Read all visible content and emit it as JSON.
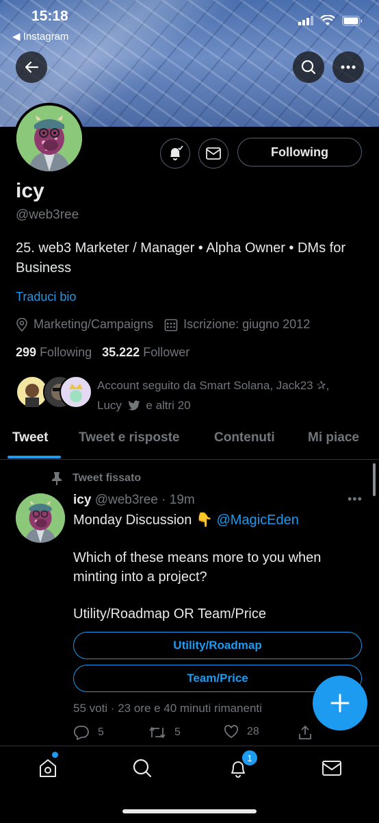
{
  "status_bar": {
    "time": "15:18",
    "back_app": "◀ Instagram"
  },
  "profile": {
    "following_button": "Following",
    "name": "icy",
    "handle": "@web3ree",
    "bio": "25. web3 Marketer / Manager • Alpha Owner • DMs for Business",
    "translate_bio": "Traduci bio",
    "category": "Marketing/Campaigns",
    "joined": "Iscrizione: giugno 2012",
    "following_count": "299",
    "following_label": "Following",
    "follower_count": "35.222",
    "follower_label": "Follower",
    "followed_by_line1": "Account seguito da Smart Solana, Jack23 ✰,",
    "followed_by_line2_a": "Lucy",
    "followed_by_line2_b": "e altri 20"
  },
  "tabs": [
    "Tweet",
    "Tweet e risposte",
    "Contenuti",
    "Mi piace"
  ],
  "tweet": {
    "pinned_label": "Tweet fissato",
    "author_name": "icy",
    "author_meta": "@web3ree · 19m",
    "text_line1_prefix": "Monday Discussion",
    "text_line1_emoji": "👇",
    "text_mention": "@MagicEden",
    "text_para2": "Which of these means more to you when minting into a project?",
    "text_para3": "Utility/Roadmap OR Team/Price",
    "poll_options": [
      "Utility/Roadmap",
      "Team/Price"
    ],
    "poll_info": "55 voti · 23 ore e 40 minuti rimanenti",
    "replies": "5",
    "retweets": "5",
    "likes": "28"
  },
  "bottom_nav": {
    "notifications_badge": "1"
  },
  "colors": {
    "accent": "#1d9bf0",
    "background": "#000000",
    "muted": "#71767b"
  }
}
